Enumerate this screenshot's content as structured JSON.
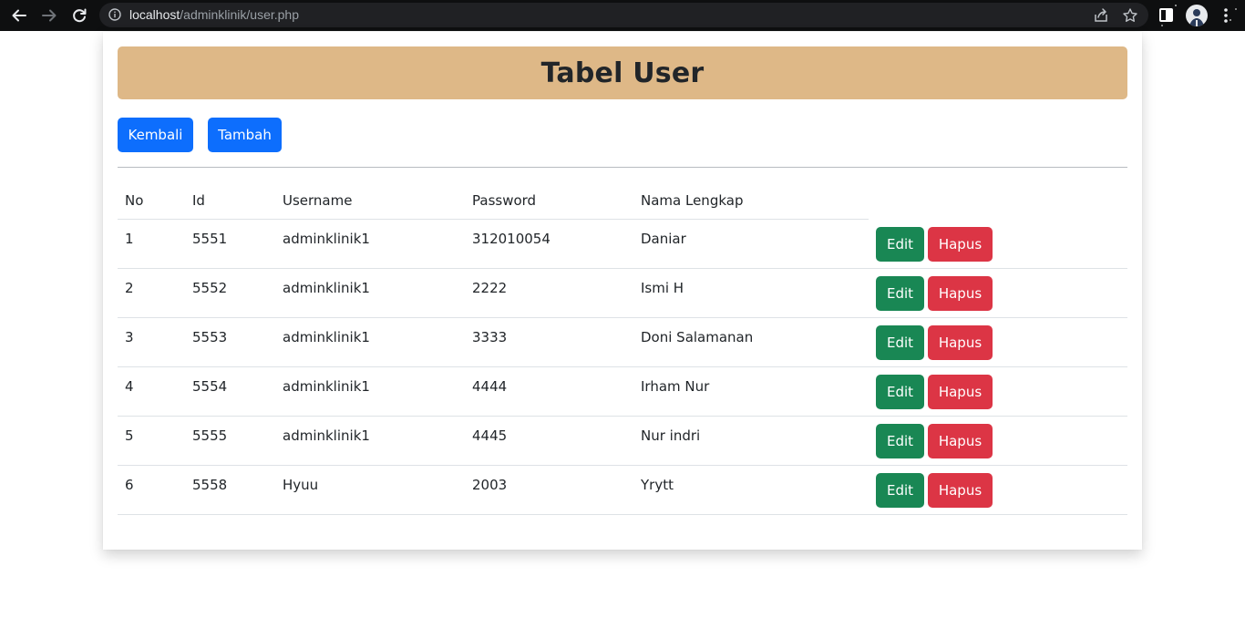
{
  "browser": {
    "url_host": "localhost",
    "url_path": "/adminklinik/user.php",
    "icons": {
      "back": "arrow-left-icon",
      "forward": "arrow-right-icon",
      "reload": "reload-icon",
      "info": "info-icon",
      "share": "share-icon",
      "bookmark": "star-icon",
      "extensions": "sidebar-icon",
      "profile": "avatar",
      "menu": "kebab-menu-icon"
    }
  },
  "page": {
    "title": "Tabel User",
    "buttons": {
      "back": "Kembali",
      "add": "Tambah"
    },
    "colors": {
      "title_bg": "#deb887",
      "primary": "#0d6efd",
      "success": "#198754",
      "danger": "#dc3545"
    }
  },
  "table": {
    "headers": [
      "No",
      "Id",
      "Username",
      "Password",
      "Nama Lengkap"
    ],
    "rows": [
      {
        "no": "1",
        "id": "5551",
        "username": "adminklinik1",
        "password": "312010054",
        "nama": "Daniar",
        "edit": "Edit",
        "hapus": "Hapus"
      },
      {
        "no": "2",
        "id": "5552",
        "username": "adminklinik1",
        "password": "2222",
        "nama": "Ismi H",
        "edit": "Edit",
        "hapus": "Hapus"
      },
      {
        "no": "3",
        "id": "5553",
        "username": "adminklinik1",
        "password": "3333",
        "nama": "Doni Salamanan",
        "edit": "Edit",
        "hapus": "Hapus"
      },
      {
        "no": "4",
        "id": "5554",
        "username": "adminklinik1",
        "password": "4444",
        "nama": "Irham Nur",
        "edit": "Edit",
        "hapus": "Hapus"
      },
      {
        "no": "5",
        "id": "5555",
        "username": "adminklinik1",
        "password": "4445",
        "nama": "Nur indri",
        "edit": "Edit",
        "hapus": "Hapus"
      },
      {
        "no": "6",
        "id": "5558",
        "username": "Hyuu",
        "password": "2003",
        "nama": "Yrytt",
        "edit": "Edit",
        "hapus": "Hapus"
      }
    ]
  }
}
